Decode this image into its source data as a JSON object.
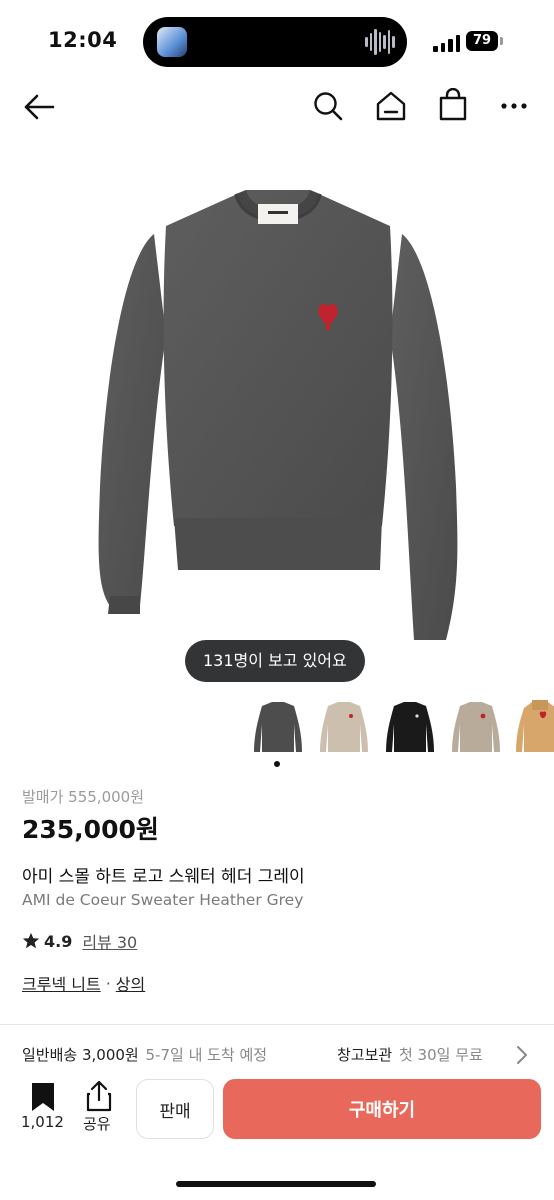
{
  "status_bar": {
    "time": "12:04",
    "battery": "79"
  },
  "icons": {
    "back": "arrow-left-icon",
    "search": "search-icon",
    "home": "home-icon",
    "bag": "shopping-bag-icon",
    "more": "more-horizontal-icon",
    "bookmark": "bookmark-icon",
    "share": "share-icon",
    "chevron": "chevron-right-icon",
    "star": "star-icon"
  },
  "product": {
    "viewers_text": "131명이 보고 있어요",
    "thumbnails": [
      "charcoal",
      "beige",
      "black",
      "taupe",
      "camel"
    ],
    "release_price": "발매가 555,000원",
    "price": "235,000원",
    "name_ko": "아미 스몰 하트 로고 스웨터 헤더 그레이",
    "name_en": "AMI de Coeur Sweater Heather Grey",
    "rating": "4.9",
    "review_label": "리뷰 30",
    "category_primary": "크루넥 니트",
    "category_separator": "·",
    "category_secondary": "상의"
  },
  "shipping": {
    "standard_label": "일반배송 3,000원",
    "standard_detail": "5-7일 내 도착 예정",
    "storage_label": "창고보관",
    "storage_detail": "첫 30일 무료"
  },
  "bottom_bar": {
    "bookmark_count": "1,012",
    "share_label": "공유",
    "sell_label": "판매",
    "buy_label": "구매하기"
  },
  "colors": {
    "buy_button": "#e8695b",
    "sweater": "#555555",
    "logo_heart": "#c0232c"
  }
}
